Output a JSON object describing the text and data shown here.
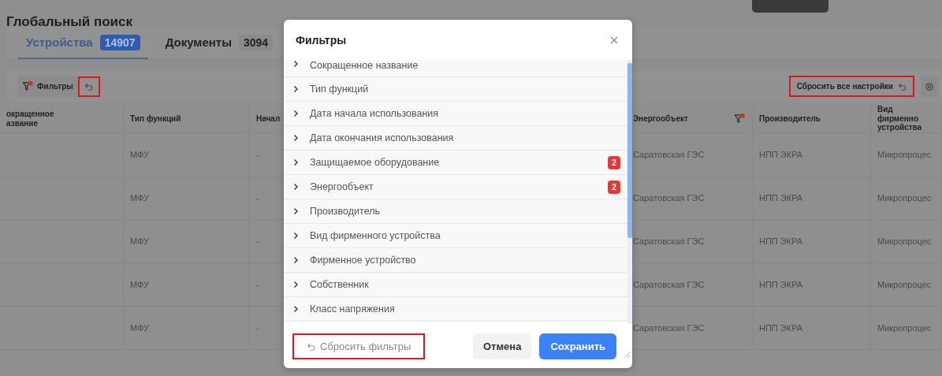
{
  "page": {
    "title": "Глобальный поиск"
  },
  "tabs": [
    {
      "label": "Устройства",
      "count": "14907",
      "selected": true
    },
    {
      "label": "Документы",
      "count": "3094",
      "selected": false
    }
  ],
  "toolbar": {
    "filter_button": {
      "label": "Фильтры",
      "active": true
    },
    "reset_icon_button": {
      "highlighted": true
    },
    "reset_all_button": {
      "label": "Сбросить все настройки",
      "highlighted": true
    }
  },
  "table": {
    "columns": [
      {
        "label": "окращенное\nазвание",
        "filtered": false
      },
      {
        "label": "Тип функций",
        "filtered": false
      },
      {
        "label": "Начал",
        "filtered": false
      },
      {
        "label": "Энергообъект",
        "filtered": true
      },
      {
        "label": "Производитель",
        "filtered": false
      },
      {
        "label": "Вид фирменно\nустройства",
        "filtered": false
      }
    ],
    "rows": [
      [
        "",
        "МФУ",
        "-",
        "Саратовская ГЭС",
        "НПП ЭКРА",
        "Микропроцес"
      ],
      [
        "",
        "МФУ",
        "-",
        "Саратовская ГЭС",
        "НПП ЭКРА",
        "Микропроцес"
      ],
      [
        "",
        "МФУ",
        "-",
        "Саратовская ГЭС",
        "НПП ЭКРА",
        "Микропроцес"
      ],
      [
        "",
        "МФУ",
        "-",
        "Саратовская ГЭС",
        "НПП ЭКРА",
        "Микропроцес"
      ],
      [
        "",
        "МФУ",
        "-",
        "Саратовская ГЭС",
        "НПП ЭКРА",
        "Микропроцес"
      ]
    ]
  },
  "dialog": {
    "title": "Фильтры",
    "items": [
      {
        "label": "Сокращенное название"
      },
      {
        "label": "Тип функций"
      },
      {
        "label": "Дата начала использования"
      },
      {
        "label": "Дата окончания использования"
      },
      {
        "label": "Защищаемое оборудование",
        "count": "2"
      },
      {
        "label": "Энергообъект",
        "count": "2"
      },
      {
        "label": "Производитель"
      },
      {
        "label": "Вид фирменного устройства"
      },
      {
        "label": "Фирменное устройство"
      },
      {
        "label": "Собственник"
      },
      {
        "label": "Класс напряжения"
      }
    ],
    "reset_button": {
      "label": "Сбросить фильтры",
      "highlighted": true
    },
    "cancel_button": "Отмена",
    "save_button": "Сохранить"
  }
}
